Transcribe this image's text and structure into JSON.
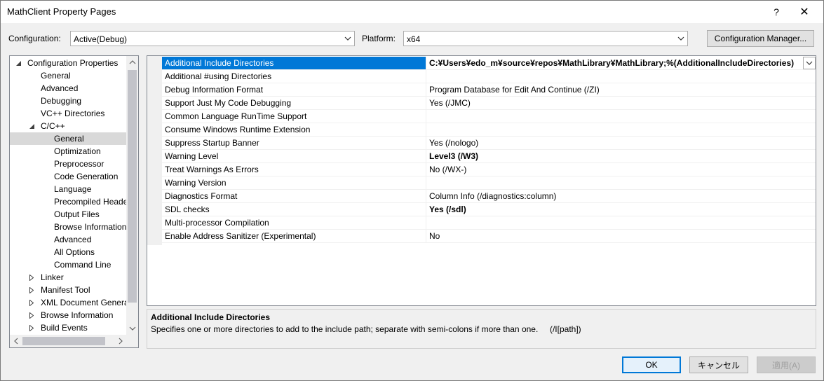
{
  "window": {
    "title": "MathClient Property Pages",
    "help_glyph": "?",
    "close_glyph": "✕"
  },
  "config_bar": {
    "configuration_label": "Configuration:",
    "configuration_value": "Active(Debug)",
    "platform_label": "Platform:",
    "platform_value": "x64",
    "manager_button": "Configuration Manager..."
  },
  "tree": {
    "items": [
      {
        "label": "Configuration Properties",
        "expander": "expanded"
      },
      {
        "label": "General",
        "expander": "none"
      },
      {
        "label": "Advanced",
        "expander": "none"
      },
      {
        "label": "Debugging",
        "expander": "none"
      },
      {
        "label": "VC++ Directories",
        "expander": "none"
      },
      {
        "label": "C/C++",
        "expander": "expanded"
      },
      {
        "label": "General",
        "expander": "none",
        "selected": true
      },
      {
        "label": "Optimization",
        "expander": "none"
      },
      {
        "label": "Preprocessor",
        "expander": "none"
      },
      {
        "label": "Code Generation",
        "expander": "none"
      },
      {
        "label": "Language",
        "expander": "none"
      },
      {
        "label": "Precompiled Heade",
        "expander": "none"
      },
      {
        "label": "Output Files",
        "expander": "none"
      },
      {
        "label": "Browse Information",
        "expander": "none"
      },
      {
        "label": "Advanced",
        "expander": "none"
      },
      {
        "label": "All Options",
        "expander": "none"
      },
      {
        "label": "Command Line",
        "expander": "none"
      },
      {
        "label": "Linker",
        "expander": "collapsed"
      },
      {
        "label": "Manifest Tool",
        "expander": "collapsed"
      },
      {
        "label": "XML Document Genera",
        "expander": "collapsed"
      },
      {
        "label": "Browse Information",
        "expander": "collapsed"
      },
      {
        "label": "Build Events",
        "expander": "collapsed"
      }
    ]
  },
  "properties": {
    "rows": [
      {
        "name": "Additional Include Directories",
        "value": "C:¥Users¥edo_m¥source¥repos¥MathLibrary¥MathLibrary;%(AdditionalIncludeDirectories)",
        "bold": true,
        "selected": true
      },
      {
        "name": "Additional #using Directories",
        "value": "",
        "bold": false
      },
      {
        "name": "Debug Information Format",
        "value": "Program Database for Edit And Continue (/ZI)",
        "bold": false
      },
      {
        "name": "Support Just My Code Debugging",
        "value": "Yes (/JMC)",
        "bold": false
      },
      {
        "name": "Common Language RunTime Support",
        "value": "",
        "bold": false
      },
      {
        "name": "Consume Windows Runtime Extension",
        "value": "",
        "bold": false
      },
      {
        "name": "Suppress Startup Banner",
        "value": "Yes (/nologo)",
        "bold": false
      },
      {
        "name": "Warning Level",
        "value": "Level3 (/W3)",
        "bold": true
      },
      {
        "name": "Treat Warnings As Errors",
        "value": "No (/WX-)",
        "bold": false
      },
      {
        "name": "Warning Version",
        "value": "",
        "bold": false
      },
      {
        "name": "Diagnostics Format",
        "value": "Column Info (/diagnostics:column)",
        "bold": false
      },
      {
        "name": "SDL checks",
        "value": "Yes (/sdl)",
        "bold": true
      },
      {
        "name": "Multi-processor Compilation",
        "value": "",
        "bold": false
      },
      {
        "name": "Enable Address Sanitizer (Experimental)",
        "value": "No",
        "bold": false
      }
    ]
  },
  "description": {
    "title": "Additional Include Directories",
    "text": "Specifies one or more directories to add to the include path; separate with semi-colons if more than one.     (/I[path])"
  },
  "buttons": {
    "ok": "OK",
    "cancel": "キャンセル",
    "apply": "適用(A)"
  },
  "colors": {
    "selection_blue": "#0078d7",
    "tree_selected": "#d9d9d9"
  }
}
